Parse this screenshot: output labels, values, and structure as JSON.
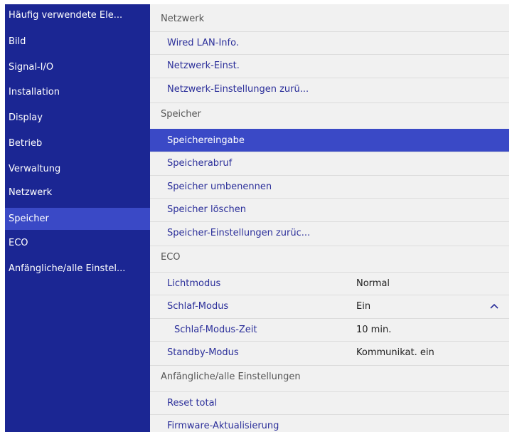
{
  "sidebar": {
    "items": [
      {
        "label": "Häufig verwendete Ele..."
      },
      {
        "label": "Bild"
      },
      {
        "label": "Signal-I/O"
      },
      {
        "label": "Installation"
      },
      {
        "label": "Display"
      },
      {
        "label": "Betrieb"
      },
      {
        "label": "Verwaltung"
      },
      {
        "label": "Netzwerk"
      },
      {
        "label": "Speicher"
      },
      {
        "label": "ECO"
      },
      {
        "label": "Anfängliche/alle Einstel..."
      }
    ],
    "selected_label": "Speicher",
    "background_color": "#1b2693",
    "selected_color": "#3a49c6"
  },
  "panel": {
    "network": {
      "title": "Netzwerk",
      "items": [
        {
          "label": "Wired LAN-Info."
        },
        {
          "label": "Netzwerk-Einst."
        },
        {
          "label": "Netzwerk-Einstellungen zurü..."
        }
      ]
    },
    "memory": {
      "title": "Speicher",
      "items": [
        {
          "label": "Speichereingabe"
        },
        {
          "label": "Speicherabruf"
        },
        {
          "label": "Speicher umbenennen"
        },
        {
          "label": "Speicher löschen"
        },
        {
          "label": "Speicher-Einstellungen zurüc..."
        }
      ],
      "selected_label": "Speichereingabe"
    },
    "eco": {
      "title": "ECO",
      "items": [
        {
          "label": "Lichtmodus",
          "value": "Normal"
        },
        {
          "label": "Schlaf-Modus",
          "value": "Ein",
          "icon": "chevron-up-icon"
        },
        {
          "label": "Schlaf-Modus-Zeit",
          "value": "10 min."
        },
        {
          "label": "Standby-Modus",
          "value": "Kommunikat. ein"
        }
      ]
    },
    "initial": {
      "title": "Anfängliche/alle Einstellungen",
      "items": [
        {
          "label": "Reset total"
        },
        {
          "label": "Firmware-Aktualisierung"
        }
      ]
    }
  }
}
